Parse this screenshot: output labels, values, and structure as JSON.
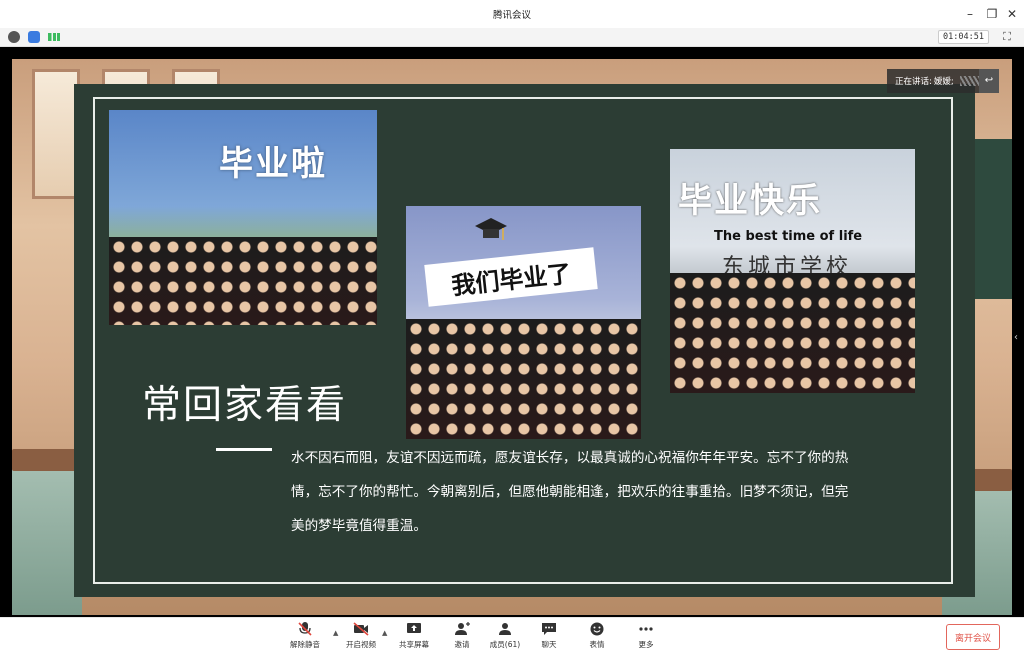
{
  "window": {
    "title": "腾讯会议",
    "minimize_icon": "minimize-icon",
    "restore_icon": "restore-icon",
    "close_icon": "close-icon"
  },
  "infobar": {
    "timer": "01:04:51",
    "icons": [
      "info-icon",
      "shield-icon",
      "signal-icon"
    ],
    "fullscreen_icon": "fullscreen-icon"
  },
  "speaking": {
    "label": "正在讲话:",
    "name": "嫒嫒;"
  },
  "slide": {
    "photo1_text": "毕业啦",
    "photo2_text": "我们毕业了",
    "photo3_title": "毕业快乐",
    "photo3_subtitle": "The best time of life",
    "photo3_school": "东城市学校",
    "heading": "常回家看看",
    "paragraph": "水不因石而阻，友谊不因远而疏，愿友谊长存，以最真诚的心祝福你年年平安。忘不了你的热情，忘不了你的帮忙。今朝离别后，但愿他朝能相逢，把欢乐的往事重拾。旧梦不须记，但完美的梦毕竟值得重温。"
  },
  "toolbar": {
    "unmute": "解除静音",
    "start_video": "开启视频",
    "share_screen": "共享屏幕",
    "invite": "邀请",
    "members": "成员(61)",
    "chat": "聊天",
    "reactions": "表情",
    "more": "更多",
    "leave": "离开会议"
  },
  "colors": {
    "chalkboard": "#2c3d34",
    "leave_red": "#e05348"
  }
}
